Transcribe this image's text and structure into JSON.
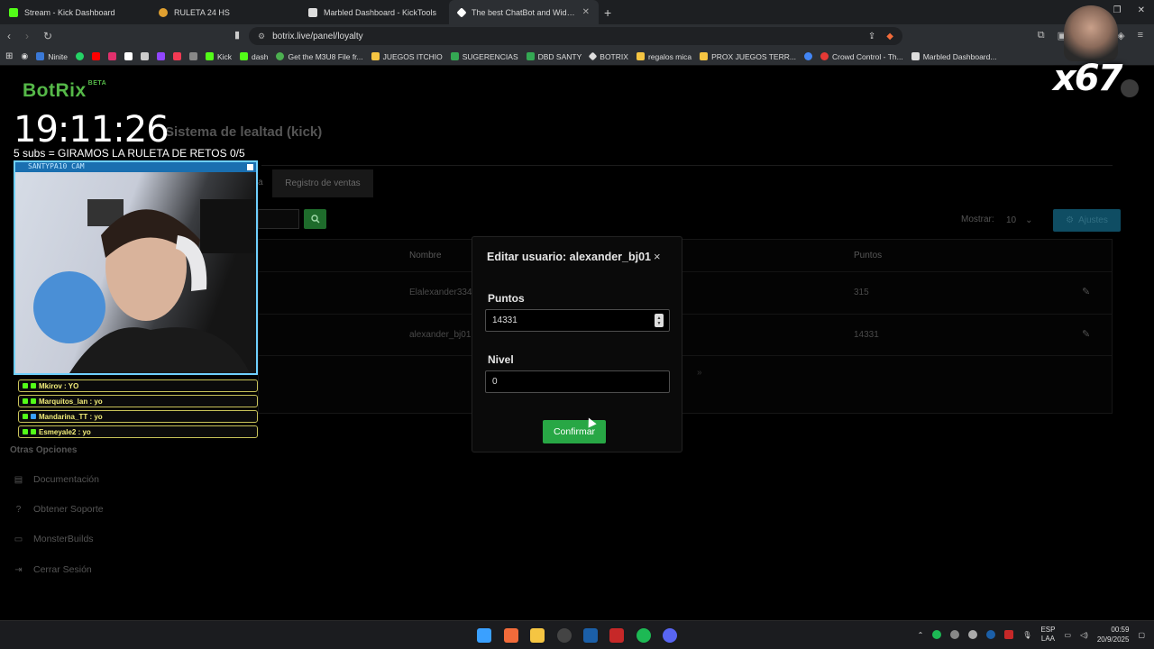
{
  "browser": {
    "tabs": [
      {
        "title": "Stream - Kick Dashboard",
        "color": "#53fc18",
        "active": false
      },
      {
        "title": "RULETA 24 HS",
        "color": "#e0a030",
        "active": false
      },
      {
        "title": "Marbled Dashboard - KickTools",
        "color": "#dddddd",
        "active": false
      },
      {
        "title": "The best ChatBot and Widgets f",
        "color": "#ffffff",
        "active": true
      }
    ],
    "new_tab": "+",
    "url": "botrix.live/panel/loyalty",
    "bookmarks": [
      {
        "label": "Ninite",
        "color": "#3a78d6"
      },
      {
        "label": "",
        "color": "#25d366"
      },
      {
        "label": "",
        "color": "#ff0000"
      },
      {
        "label": "",
        "color": "#e1306c"
      },
      {
        "label": "",
        "color": "#ffffff"
      },
      {
        "label": "",
        "color": "#cccccc"
      },
      {
        "label": "",
        "color": "#9146ff"
      },
      {
        "label": "",
        "color": "#f23a54"
      },
      {
        "label": "",
        "color": "#888888"
      },
      {
        "label": "Kick",
        "color": "#53fc18"
      },
      {
        "label": "dash",
        "color": "#53fc18"
      },
      {
        "label": "Get the M3U8 File fr...",
        "color": "#4caf50"
      },
      {
        "label": "JUEGOS ITCHIO",
        "color": "#f5c542"
      },
      {
        "label": "SUGERENCIAS",
        "color": "#34a853"
      },
      {
        "label": "DBD SANTY",
        "color": "#34a853"
      },
      {
        "label": "BOTRIX",
        "color": "#dddddd"
      },
      {
        "label": "regalos mica",
        "color": "#f5c542"
      },
      {
        "label": "PROX JUEGOS TERR...",
        "color": "#f5c542"
      },
      {
        "label": "",
        "color": "#4285f4"
      },
      {
        "label": "Crowd Control - Th...",
        "color": "#e53935"
      },
      {
        "label": "Marbled Dashboard...",
        "color": "#dddddd"
      }
    ]
  },
  "page": {
    "logo": "BotRix",
    "logo_badge": "BETA",
    "title": "Sistema de lealtad (kick)",
    "tab_partial": "a",
    "tab_ventas": "Registro de ventas",
    "mostrar_label": "Mostrar:",
    "mostrar_value": "10",
    "ajustes_label": "Ajustes",
    "table": {
      "col_nombre": "Nombre",
      "col_puntos": "Puntos",
      "rows": [
        {
          "nombre": "Elalexander334",
          "puntos": "315"
        },
        {
          "nombre": "alexander_bj01",
          "puntos": "14331"
        }
      ],
      "pager": "»"
    },
    "otras_opciones": "Otras Opciones",
    "side_items": [
      {
        "label": "Documentación",
        "icon": "document-icon"
      },
      {
        "label": "Obtener Soporte",
        "icon": "help-icon"
      },
      {
        "label": "MonsterBuilds",
        "icon": "monitor-icon"
      },
      {
        "label": "Cerrar Sesión",
        "icon": "logout-icon"
      }
    ]
  },
  "modal": {
    "title": "Editar usuario: alexander_bj01",
    "close": "×",
    "puntos_label": "Puntos",
    "puntos_value": "14331",
    "nivel_label": "Nivel",
    "nivel_value": "0",
    "confirm_label": "Confirmar"
  },
  "overlay": {
    "clock": "19:11:26",
    "goal": "5 subs = GIRAMOS LA RULETA DE RETOS 0/5",
    "cam_label": "SANTYPA10 CAM",
    "chat": [
      {
        "text": "Mkirov : YO"
      },
      {
        "text": "Marquitos_lan : yo"
      },
      {
        "text": "Mandarina_TT : yo"
      },
      {
        "text": "Esmeyale2 : yo"
      }
    ],
    "badge_text": "x67"
  },
  "taskbar": {
    "lang_1": "ESP",
    "lang_2": "LAA",
    "time": "00:59",
    "date": "20/9/2025"
  }
}
